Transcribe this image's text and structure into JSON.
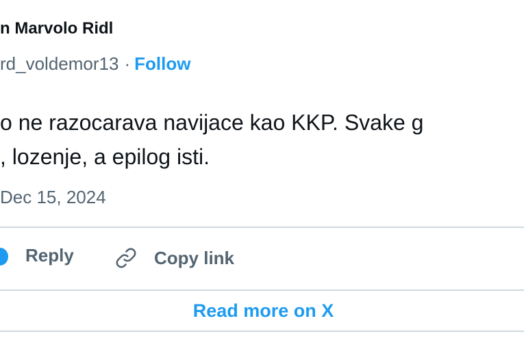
{
  "author": {
    "display_name": "n Marvolo Ridl",
    "handle": "rd_voldemor13",
    "separator": "·",
    "follow_label": "Follow"
  },
  "tweet": {
    "text_lines": [
      "o ne razocarava navijace kao KKP. Svake g",
      ", lozenje, a epilog isti."
    ],
    "timestamp": "Dec 15, 2024"
  },
  "actions": {
    "reply_label": "Reply",
    "copy_link_label": "Copy link",
    "icons": [
      "heart-icon",
      "link-icon"
    ]
  },
  "footer": {
    "read_more_label": "Read more on X"
  },
  "colors": {
    "accent": "#1d9bf0",
    "text_primary": "#0f1419",
    "text_secondary": "#536471",
    "divider": "#cfd9de"
  }
}
